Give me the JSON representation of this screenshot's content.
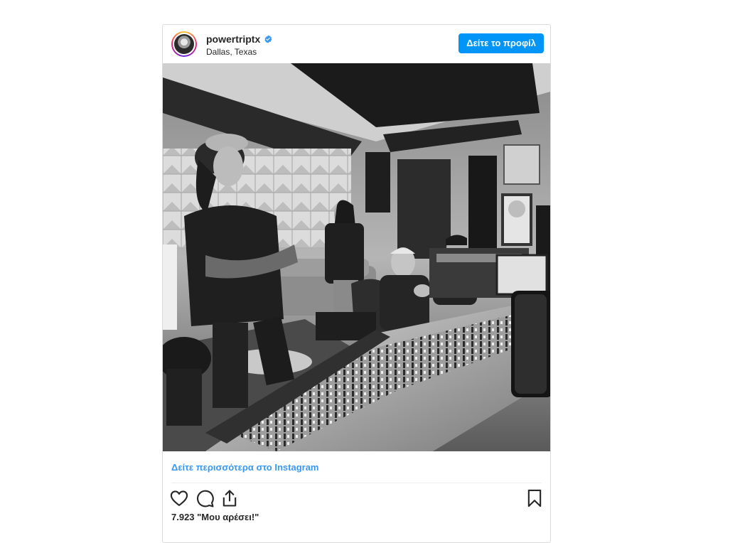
{
  "post": {
    "username": "powertriptx",
    "verified": true,
    "location": "Dallas, Texas",
    "profile_button": "Δείτε το προφίλ",
    "see_more": "Δείτε περισσότερα στο Instagram",
    "likes": "7.923 \"Μου αρέσει!\""
  },
  "icons": {
    "like": "heart-icon",
    "comment": "comment-icon",
    "share": "share-icon",
    "save": "bookmark-icon",
    "verified": "verified-badge-icon"
  },
  "colors": {
    "accent": "#0095f6",
    "link": "#3897f0",
    "verified": "#3897f0",
    "text": "#262626",
    "border": "#dbdbdb"
  }
}
